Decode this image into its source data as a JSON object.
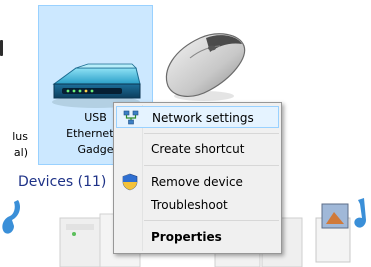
{
  "left_item": {
    "label_lines": [
      "lus",
      "al)"
    ]
  },
  "selected_device": {
    "label_lines": [
      "USB",
      "Ethernet/R",
      "Gadge"
    ]
  },
  "devices_heading": "Devices (11)",
  "context_menu": {
    "items": [
      {
        "label": "Network settings",
        "icon": "network-settings-icon",
        "highlighted": true
      },
      {
        "label": "Create shortcut"
      },
      {
        "label": "Remove device",
        "icon": "uac-shield-icon"
      },
      {
        "label": "Troubleshoot"
      },
      {
        "label": "Properties",
        "bold": true
      }
    ]
  },
  "colors": {
    "selection_fill": "#cce8ff",
    "selection_border": "#99d1ff",
    "heading_text": "#1e3287",
    "menu_background": "#f0f0f0"
  }
}
